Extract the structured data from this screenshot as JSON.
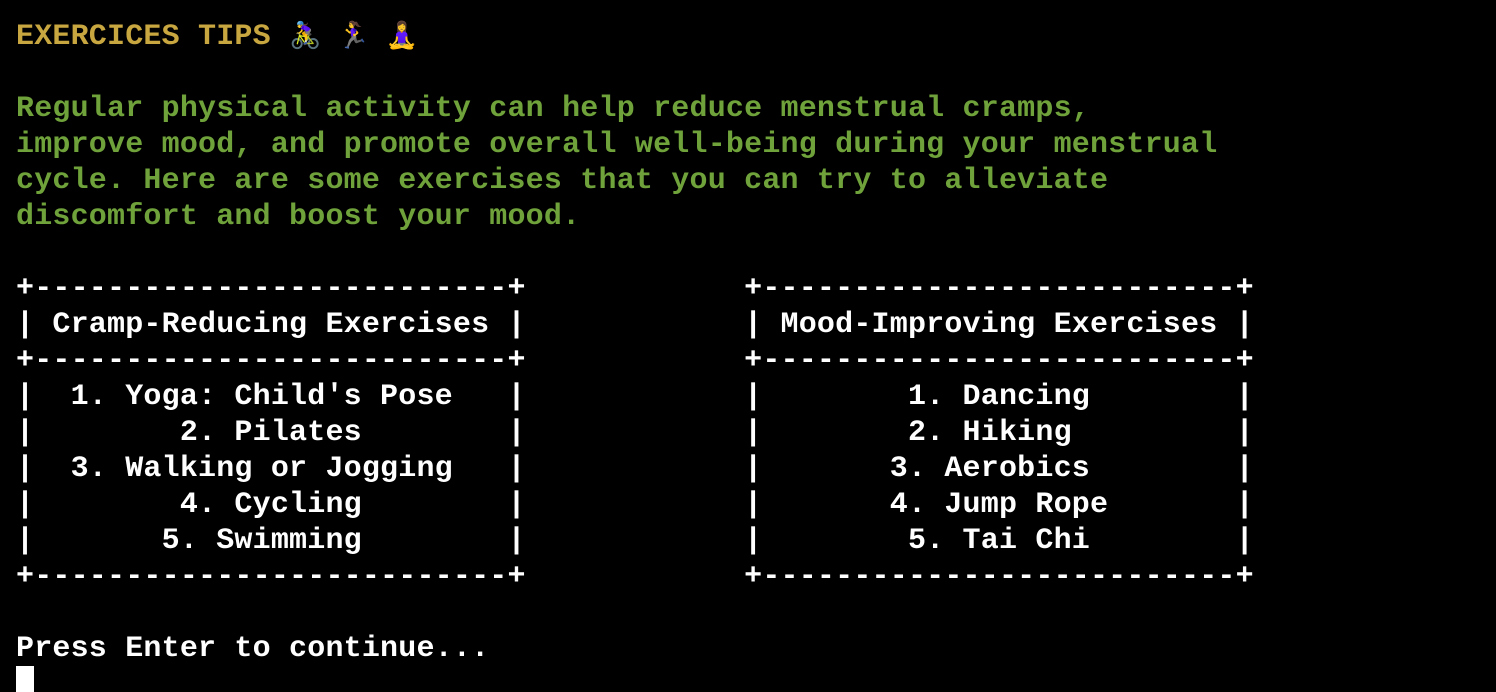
{
  "header": {
    "title": "EXERCICES TIPS",
    "emojis": "🚴‍♀️ 🏃‍♀️ 🧘‍♀️"
  },
  "intro": {
    "lines": [
      "Regular physical activity can help reduce menstrual cramps,",
      "improve mood, and promote overall well-being during your menstrual",
      "cycle. Here are some exercises that you can try to alleviate",
      "discomfort and boost your mood."
    ]
  },
  "tables": {
    "lines": [
      "+--------------------------+            +--------------------------+",
      "| Cramp-Reducing Exercises |            | Mood-Improving Exercises |",
      "+--------------------------+            +--------------------------+",
      "|  1. Yoga: Child's Pose   |            |        1. Dancing        |",
      "|        2. Pilates        |            |        2. Hiking         |",
      "|  3. Walking or Jogging   |            |       3. Aerobics        |",
      "|        4. Cycling        |            |       4. Jump Rope       |",
      "|       5. Swimming        |            |        5. Tai Chi        |",
      "+--------------------------+            +--------------------------+"
    ],
    "cramp_reducing": {
      "header": "Cramp-Reducing Exercises",
      "items": [
        "1. Yoga: Child's Pose",
        "2. Pilates",
        "3. Walking or Jogging",
        "4. Cycling",
        "5. Swimming"
      ]
    },
    "mood_improving": {
      "header": "Mood-Improving Exercises",
      "items": [
        "1. Dancing",
        "2. Hiking",
        "3. Aerobics",
        "4. Jump Rope",
        "5. Tai Chi"
      ]
    }
  },
  "prompt": {
    "text": "Press Enter to continue..."
  },
  "colors": {
    "background": "#000000",
    "title": "#c8a640",
    "intro": "#6fa23a",
    "text": "#ffffff"
  }
}
